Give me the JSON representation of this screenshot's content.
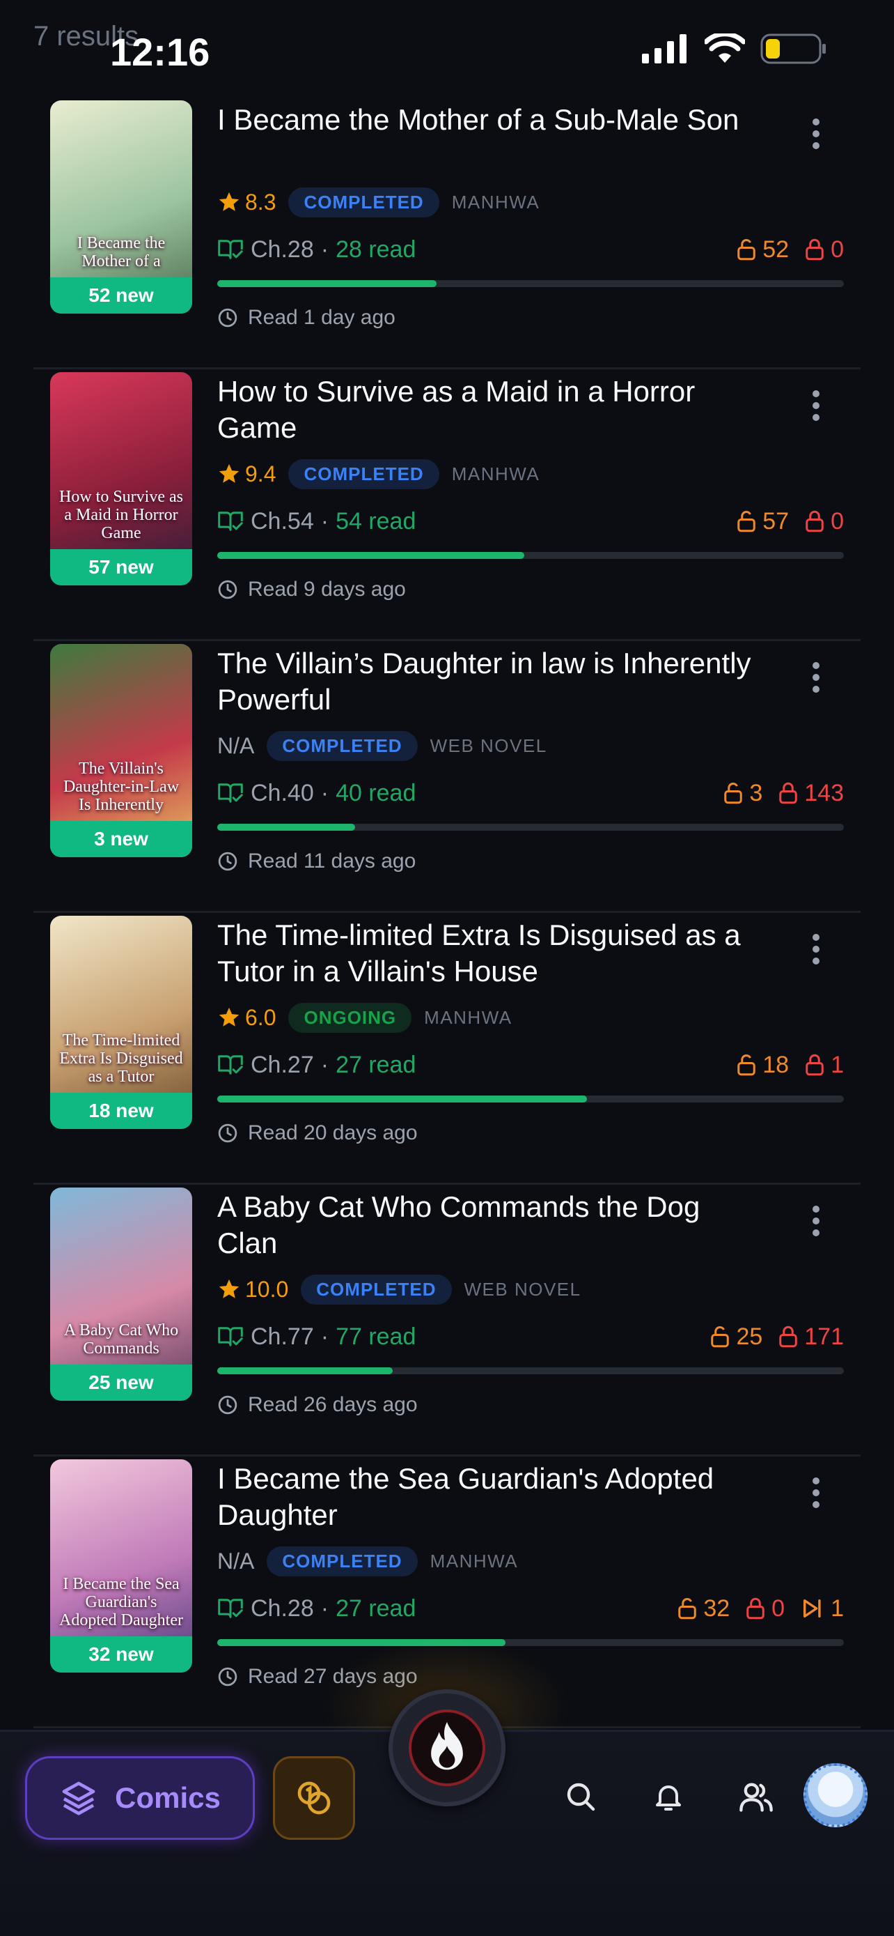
{
  "status_bar": {
    "results_text": "7 results",
    "time": "12:16"
  },
  "items": [
    {
      "title": "I Became the Mother of a Sub-Male Son",
      "cover_text": "I Became the Mother of a",
      "new_count": "52 new",
      "rating": "8.3",
      "status": "COMPLETED",
      "type": "MANHWA",
      "chapter": "Ch.28",
      "read": "28 read",
      "locked_orange": "52",
      "locked_red": "0",
      "progress": 0.35,
      "last_read": "Read 1 day ago",
      "colors": [
        "#e8ecd0",
        "#9cc4a0",
        "#4a6a4a"
      ]
    },
    {
      "title": "How to Survive as a Maid in a Horror Game",
      "cover_text": "How to Survive as a Maid in Horror Game",
      "new_count": "57 new",
      "rating": "9.4",
      "status": "COMPLETED",
      "type": "MANHWA",
      "chapter": "Ch.54",
      "read": "54 read",
      "locked_orange": "57",
      "locked_red": "0",
      "progress": 0.49,
      "last_read": "Read 9 days ago",
      "colors": [
        "#d9385a",
        "#8a1f3a",
        "#2a1f3a"
      ]
    },
    {
      "title": "The Villain’s Daughter in law is Inherently Powerful",
      "cover_text": "The Villain's Daughter-in-Law Is Inherently",
      "new_count": "3 new",
      "rating": "N/A",
      "status": "COMPLETED",
      "type": "WEB NOVEL",
      "chapter": "Ch.40",
      "read": "40 read",
      "locked_orange": "3",
      "locked_red": "143",
      "progress": 0.22,
      "last_read": "Read 11 days ago",
      "colors": [
        "#3f7a3f",
        "#c43a4a",
        "#e8c060"
      ]
    },
    {
      "title": "The Time-limited Extra Is Disguised as a Tutor in a Villain's House",
      "cover_text": "The Time-limited Extra Is Disguised as a Tutor",
      "new_count": "18 new",
      "rating": "6.0",
      "status": "ONGOING",
      "type": "MANHWA",
      "chapter": "Ch.27",
      "read": "27 read",
      "locked_orange": "18",
      "locked_red": "1",
      "progress": 0.59,
      "last_read": "Read 20 days ago",
      "colors": [
        "#f0e6c8",
        "#c8a070",
        "#6a4a2a"
      ]
    },
    {
      "title": "A Baby Cat Who Commands the Dog Clan",
      "cover_text": "A Baby Cat Who Commands",
      "new_count": "25 new",
      "rating": "10.0",
      "status": "COMPLETED",
      "type": "WEB NOVEL",
      "chapter": "Ch.77",
      "read": "77 read",
      "locked_orange": "25",
      "locked_red": "171",
      "progress": 0.28,
      "last_read": "Read 26 days ago",
      "colors": [
        "#7fb8d8",
        "#d68aa8",
        "#5a3a5a"
      ]
    },
    {
      "title": "I Became the Sea Guardian's Adopted Daughter",
      "cover_text": "I Became the Sea Guardian's Adopted Daughter",
      "new_count": "32 new",
      "rating": "N/A",
      "status": "COMPLETED",
      "type": "MANHWA",
      "chapter": "Ch.28",
      "read": "27 read",
      "locked_orange": "32",
      "locked_red": "0",
      "skip_count": "1",
      "progress": 0.46,
      "last_read": "Read 27 days ago",
      "colors": [
        "#f2c8dc",
        "#c07ab8",
        "#4a3a7a"
      ]
    }
  ],
  "nav": {
    "comics_label": "Comics"
  },
  "theme": {
    "accent_green": "#10b981",
    "accent_purple": "#a78bfa",
    "completed_blue": "#3b82f6",
    "ongoing_green": "#16a34a",
    "lock_orange": "#f0892b",
    "lock_red": "#ef4444",
    "rating_star": "#f59e0b"
  }
}
